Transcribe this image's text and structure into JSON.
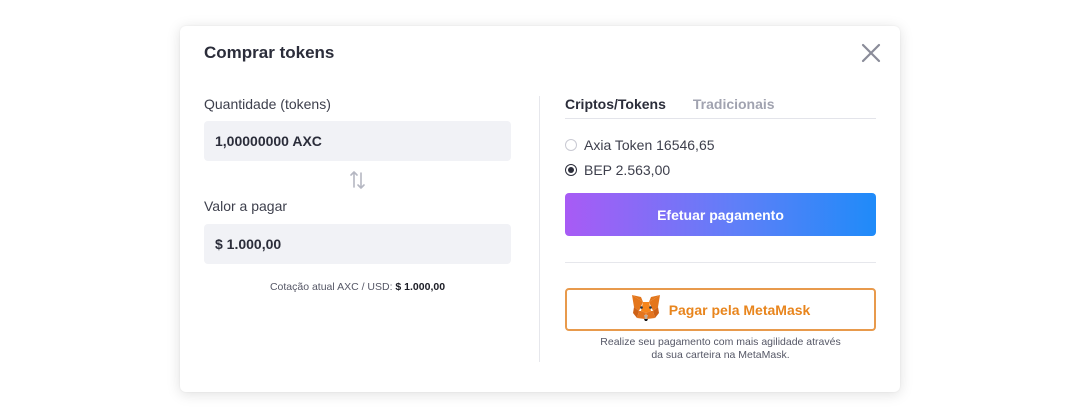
{
  "modal": {
    "title": "Comprar tokens",
    "close_icon": "close-icon"
  },
  "left": {
    "quantity_label": "Quantidade (tokens)",
    "quantity_value": "1,00000000 AXC",
    "swap_icon": "swap-arrows-icon",
    "pay_label": "Valor a pagar",
    "pay_value": "$ 1.000,00",
    "rate_prefix": "Cotação atual AXC / USD:",
    "rate_value": "$ 1.000,00"
  },
  "right": {
    "tabs": [
      {
        "label": "Criptos/Tokens",
        "active": true
      },
      {
        "label": "Tradicionais",
        "active": false
      }
    ],
    "options": [
      {
        "label": "Axia Token 16546,65",
        "checked": false
      },
      {
        "label": "BEP 2.563,00",
        "checked": true
      }
    ],
    "pay_button": "Efetuar pagamento",
    "metamask_button": "Pagar pela MetaMask",
    "metamask_icon": "metamask-fox-icon",
    "metamask_desc_line1": "Realize seu pagamento com mais agilidade através",
    "metamask_desc_line2": "da sua carteira na MetaMask."
  },
  "colors": {
    "accent_gradient_start": "#a85bf5",
    "accent_gradient_end": "#1f8bf9",
    "metamask_orange": "#e8851d",
    "field_bg": "#f1f2f6"
  }
}
